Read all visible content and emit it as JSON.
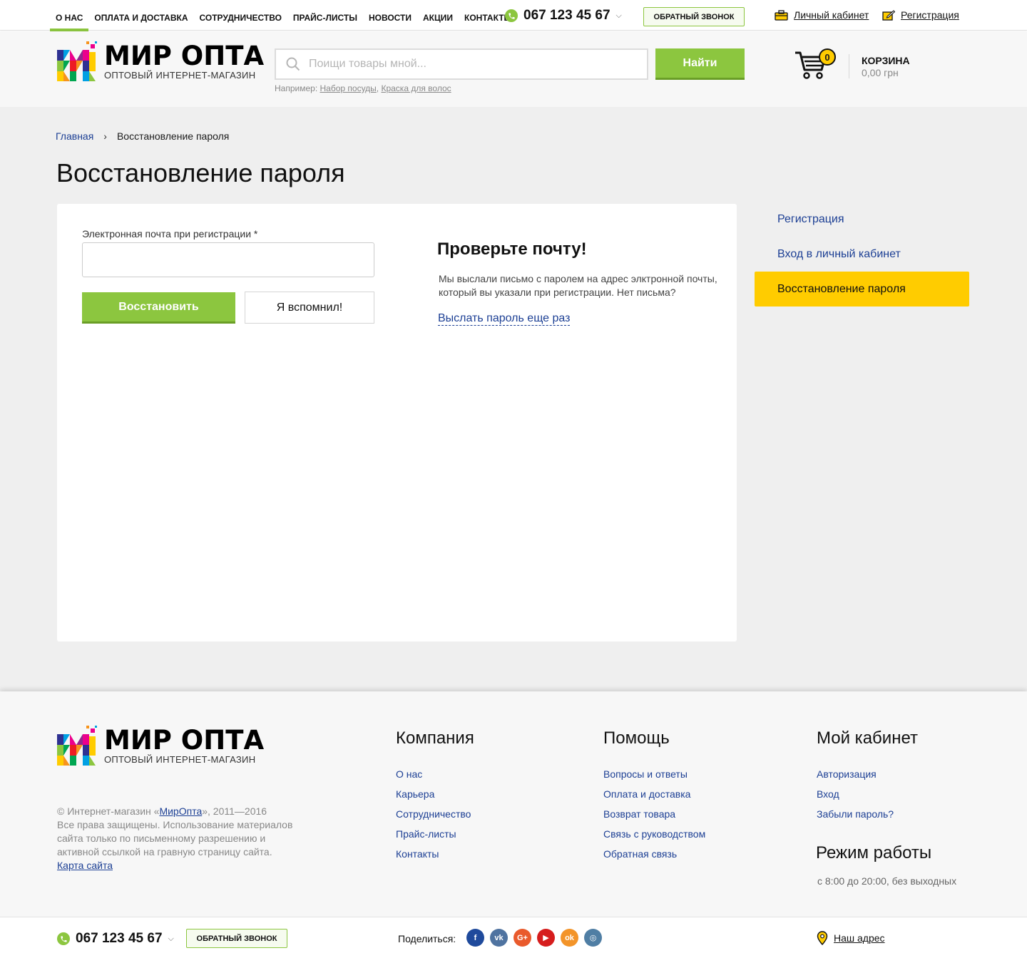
{
  "topnav": {
    "items": [
      {
        "label": "О нас",
        "active": true
      },
      {
        "label": "Оплата и доставка",
        "active": false
      },
      {
        "label": "Сотрудничество",
        "active": false
      },
      {
        "label": "Прайс-листы",
        "active": false
      },
      {
        "label": "Новости",
        "active": false
      },
      {
        "label": "Акции",
        "active": false
      },
      {
        "label": "Контакты",
        "active": false
      }
    ],
    "phone": "067 123 45 67",
    "callback_label": "Обратный звонок",
    "account_label": "Личный кабинет",
    "register_label": "Регистрация"
  },
  "header": {
    "logo_title": "МИР ОПТА",
    "logo_subtitle": "ОПТОВЫЙ ИНТЕРНЕТ-МАГАЗИН",
    "search_placeholder": "Поищи товары мной...",
    "search_button": "Найти",
    "hint_prefix": "Например:",
    "hint_links": [
      "Набор посуды",
      "Краска для волос"
    ],
    "cart_count": "0",
    "cart_title": "Корзина",
    "cart_sum": "0,00 грн"
  },
  "breadcrumb": {
    "home": "Главная",
    "separator": "›",
    "current": "Восстановление пароля"
  },
  "page": {
    "title": "Восстановление пароля",
    "email_label": "Электронная почта при регистрации *",
    "email_value": "",
    "restore_button": "Восстановить",
    "remember_button": "Я вспомнил!",
    "check_title": "Проверьте почту!",
    "check_text": "Мы выслали письмо с паролем на адрес элктронной почты, который вы указали при регистрации. Нет письма?",
    "resend_link": "Выслать пароль еще раз"
  },
  "side_menu": [
    {
      "label": "Регистрация",
      "active": false
    },
    {
      "label": "Вход в личный кабинет",
      "active": false
    },
    {
      "label": "Восстановление пароля",
      "active": true
    }
  ],
  "footer": {
    "copyright_prefix": "© Интернет-магазин «",
    "copyright_brand": "МирОпта",
    "copyright_suffix": "», 2011—2016",
    "rights": "Все права защищены. Использование материалов сайта только по письменному разрешению и активной ссылкой на гравную страницу сайта.",
    "sitemap": "Карта сайта",
    "columns": [
      {
        "title": "Компания",
        "links": [
          "О нас",
          "Карьера",
          "Сотрудничество",
          "Прайс-листы",
          "Контакты"
        ]
      },
      {
        "title": "Помощь",
        "links": [
          "Вопросы и ответы",
          "Оплата и доставка",
          "Возврат товара",
          "Связь с руководством",
          "Обратная связь"
        ]
      },
      {
        "title": "Мой кабинет",
        "links": [
          "Авторизация",
          "Вход",
          "Забыли пароль?"
        ]
      }
    ],
    "work_title": "Режим работы",
    "work_text": "с 8:00 до 20:00, без выходных"
  },
  "bottombar": {
    "phone": "067 123 45 67",
    "callback_label": "Обратный звонок",
    "share_label": "Поделиться:",
    "socials": [
      {
        "name": "facebook-icon",
        "glyph": "f",
        "color": "#1f4a9c"
      },
      {
        "name": "vk-icon",
        "glyph": "vk",
        "color": "#4f73a0"
      },
      {
        "name": "google-plus-icon",
        "glyph": "G+",
        "color": "#e95a2c"
      },
      {
        "name": "youtube-icon",
        "glyph": "▶",
        "color": "#d61d1d"
      },
      {
        "name": "odnoklassniki-icon",
        "glyph": "ok",
        "color": "#f39429"
      },
      {
        "name": "instagram-icon",
        "glyph": "◎",
        "color": "#4f7ea4"
      }
    ],
    "address_label": "Наш адрес"
  },
  "colors": {
    "accent_green": "#8cc63f",
    "highlight_yellow": "#ffcc00",
    "link_blue": "#1c3f94"
  }
}
